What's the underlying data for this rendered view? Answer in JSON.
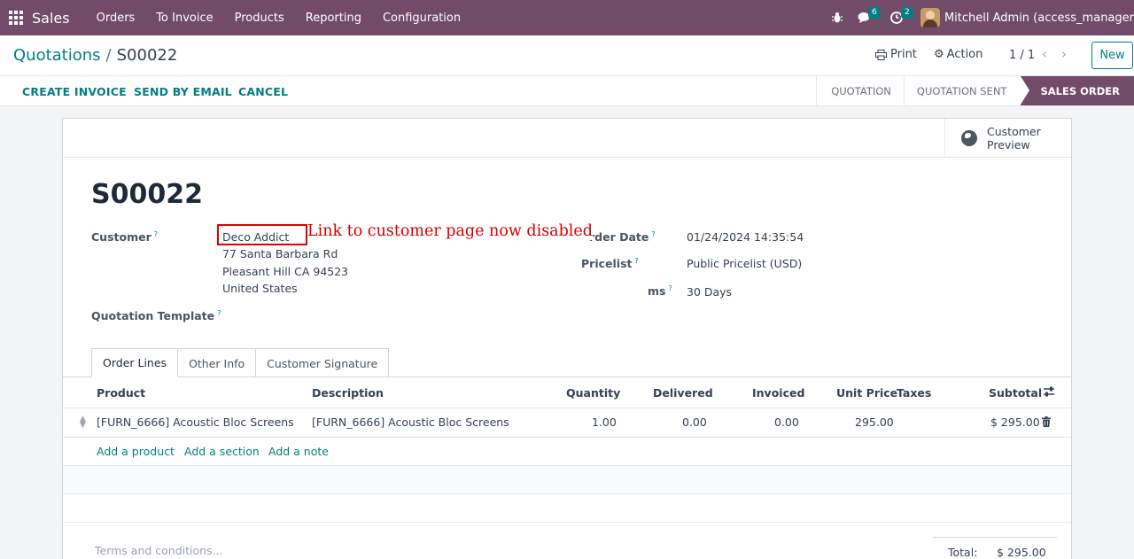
{
  "navbar": {
    "app_name": "Sales",
    "menu": [
      "Orders",
      "To Invoice",
      "Products",
      "Reporting",
      "Configuration"
    ],
    "chat_count": "6",
    "activity_count": "2",
    "user_name": "Mitchell Admin (access_manager"
  },
  "control": {
    "breadcrumb_root": "Quotations",
    "breadcrumb_sep": "/",
    "breadcrumb_current": "S00022",
    "print_label": "Print",
    "action_label": "Action",
    "pager": "1 / 1",
    "new_label": "New"
  },
  "statusbar": {
    "buttons": [
      "CREATE INVOICE",
      "SEND BY EMAIL",
      "CANCEL"
    ],
    "stages": [
      "QUOTATION",
      "QUOTATION SENT",
      "SALES ORDER"
    ],
    "active_stage": "SALES ORDER"
  },
  "sheet": {
    "preview_label": "Customer Preview",
    "title": "S00022",
    "customer_label": "Customer",
    "customer_name": "Deco Addict",
    "address": [
      "77 Santa Barbara Rd",
      "Pleasant Hill CA 94523",
      "United States"
    ],
    "template_label": "Quotation Template",
    "order_date_label": "rder Date",
    "order_date": "01/24/2024 14:35:54",
    "pricelist_label": "Pricelist",
    "pricelist": "Public Pricelist (USD)",
    "terms_label": "ms",
    "payment_terms": "30 Days",
    "annotation": "Link to customer page now disabled"
  },
  "tabs": [
    "Order Lines",
    "Other Info",
    "Customer Signature"
  ],
  "table": {
    "headers": {
      "product": "Product",
      "description": "Description",
      "quantity": "Quantity",
      "delivered": "Delivered",
      "invoiced": "Invoiced",
      "unit_price": "Unit Price",
      "taxes": "Taxes",
      "subtotal": "Subtotal"
    },
    "rows": [
      {
        "product": "[FURN_6666] Acoustic Bloc Screens",
        "description": "[FURN_6666] Acoustic Bloc Screens",
        "quantity": "1.00",
        "delivered": "0.00",
        "invoiced": "0.00",
        "unit_price": "295.00",
        "taxes": "",
        "subtotal": "$ 295.00"
      }
    ],
    "add_links": [
      "Add a product",
      "Add a section",
      "Add a note"
    ]
  },
  "footer": {
    "terms_placeholder": "Terms and conditions...",
    "total_label": "Total:",
    "total_value": "$ 295.00"
  },
  "colors": {
    "brand": "#714b67",
    "accent": "#017e84",
    "annotation": "#d40000"
  }
}
